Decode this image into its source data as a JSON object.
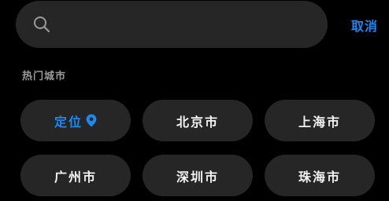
{
  "search": {
    "value": "",
    "placeholder": "",
    "icon": "search-icon"
  },
  "cancel_label": "取消",
  "section_title": "热门城市",
  "location_chip": {
    "label": "定位",
    "icon": "location-pin-icon",
    "color": "#1e88f0"
  },
  "cities": [
    "北京市",
    "上海市",
    "广州市",
    "深圳市",
    "珠海市"
  ],
  "colors": {
    "background": "#000000",
    "chip": "#262626",
    "accent": "#1e88f0"
  }
}
